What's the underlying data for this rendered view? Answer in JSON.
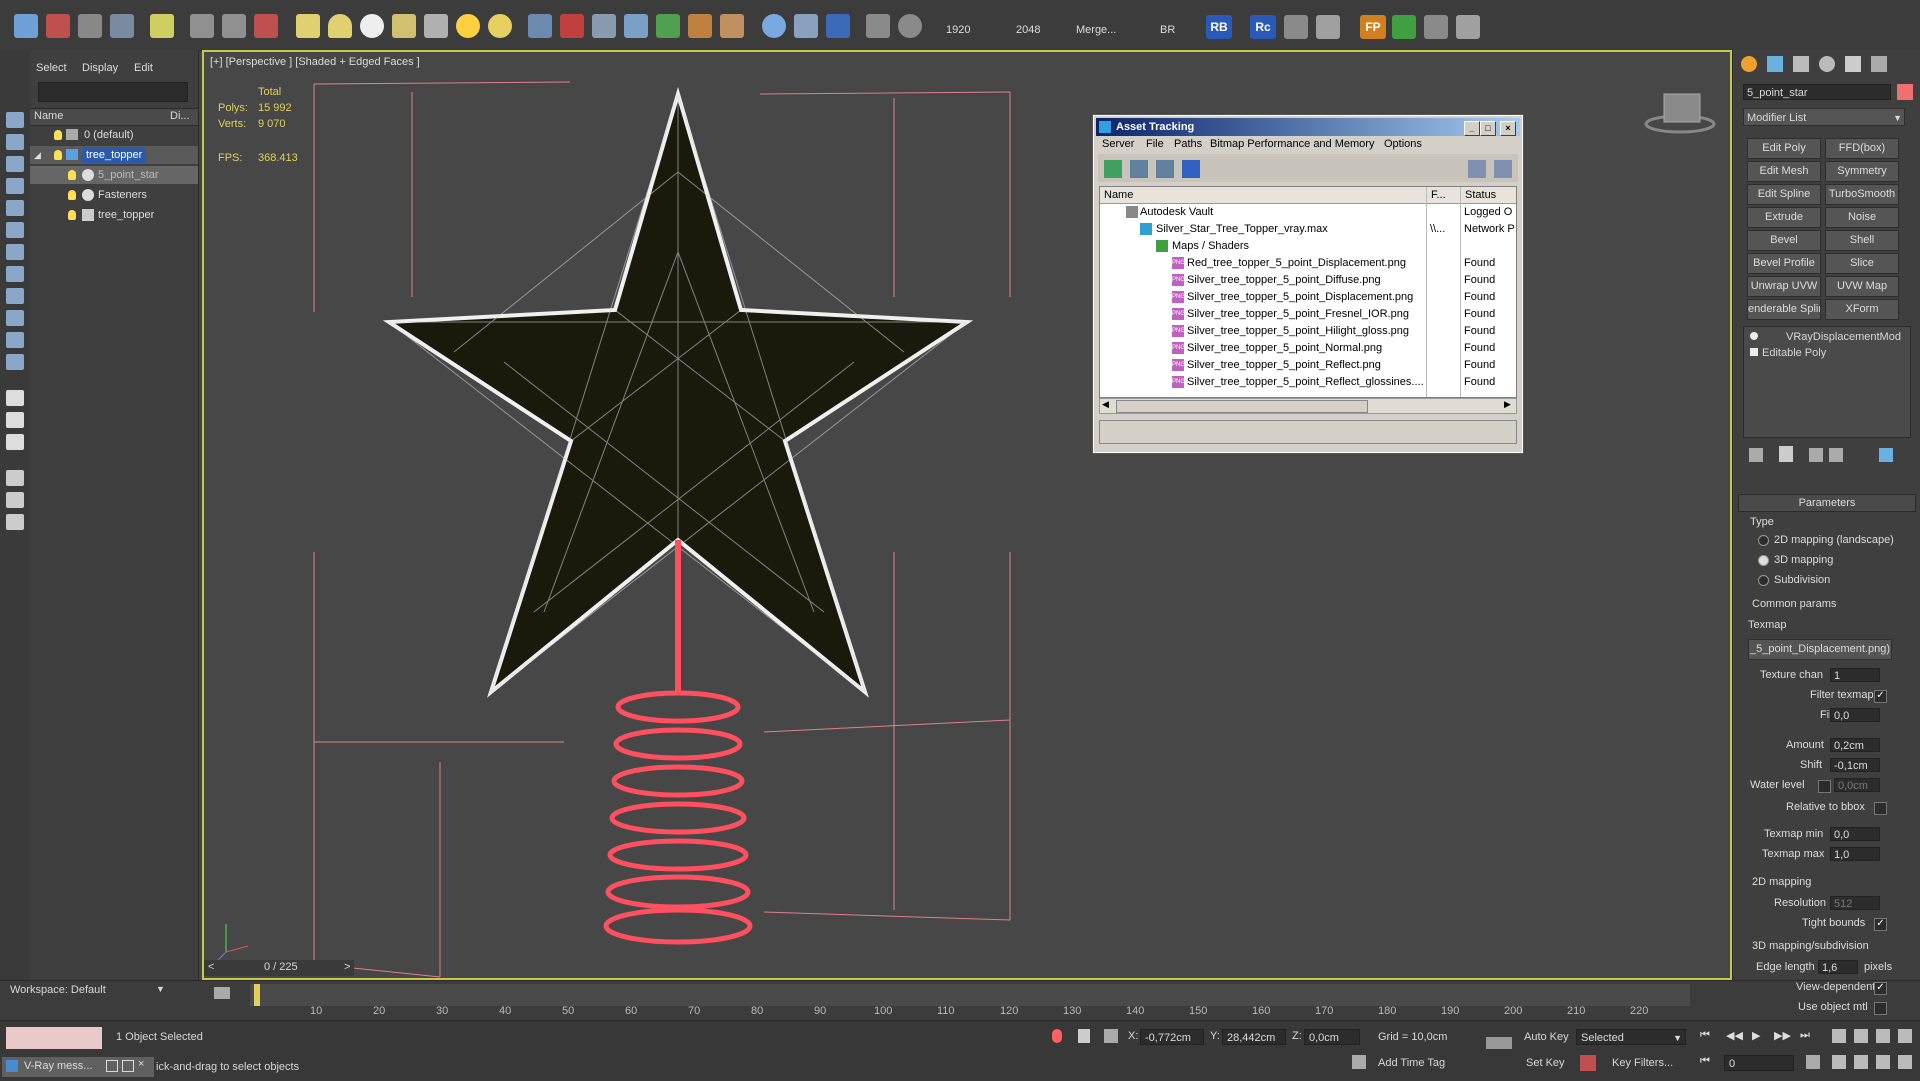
{
  "toolbar": {
    "render_width": "1920",
    "render_height": "2048",
    "merge_label": "Merge...",
    "br_label": "BR",
    "rb_label": "RB",
    "rc_label": "Rc",
    "fp_label": "FP"
  },
  "scene": {
    "menu": [
      "Select",
      "Display",
      "Edit"
    ],
    "col_name": "Name",
    "col_disp": "Di...",
    "items": [
      {
        "label": "0 (default)"
      },
      {
        "label": "tree_topper"
      },
      {
        "label": "5_point_star"
      },
      {
        "label": "Fasteners"
      },
      {
        "label": "tree_topper"
      }
    ],
    "workspace": "Workspace: Default"
  },
  "viewport": {
    "label": "[+] [Perspective ] [Shaded + Edged Faces ]",
    "stats_total": "Total",
    "polys_label": "Polys:",
    "polys_value": "15 992",
    "verts_label": "Verts:",
    "verts_value": "9 070",
    "fps_label": "FPS:",
    "fps_value": "368.413",
    "frame_counter": "0 / 225"
  },
  "asset_tracking": {
    "title": "Asset Tracking",
    "menu": [
      "Server",
      "File",
      "Paths",
      "Bitmap Performance and Memory",
      "Options"
    ],
    "col_name": "Name",
    "col_f": "F...",
    "col_status": "Status",
    "rows": [
      {
        "name": "Autodesk Vault",
        "f": "",
        "status": "Logged O"
      },
      {
        "name": "Silver_Star_Tree_Topper_vray.max",
        "f": "\\\\...",
        "status": "Network P"
      },
      {
        "name": "Maps / Shaders",
        "f": "",
        "status": ""
      },
      {
        "name": "Red_tree_topper_5_point_Displacement.png",
        "f": "",
        "status": "Found"
      },
      {
        "name": "Silver_tree_topper_5_point_Diffuse.png",
        "f": "",
        "status": "Found"
      },
      {
        "name": "Silver_tree_topper_5_point_Displacement.png",
        "f": "",
        "status": "Found"
      },
      {
        "name": "Silver_tree_topper_5_point_Fresnel_IOR.png",
        "f": "",
        "status": "Found"
      },
      {
        "name": "Silver_tree_topper_5_point_Hilight_gloss.png",
        "f": "",
        "status": "Found"
      },
      {
        "name": "Silver_tree_topper_5_point_Normal.png",
        "f": "",
        "status": "Found"
      },
      {
        "name": "Silver_tree_topper_5_point_Reflect.png",
        "f": "",
        "status": "Found"
      },
      {
        "name": "Silver_tree_topper_5_point_Reflect_glossines....",
        "f": "",
        "status": "Found"
      }
    ]
  },
  "modify": {
    "object_name": "5_point_star",
    "modifier_list": "Modifier List",
    "buttons": [
      "Edit Poly",
      "FFD(box)",
      "Edit Mesh",
      "Symmetry",
      "Edit Spline",
      "TurboSmooth",
      "Extrude",
      "Noise",
      "Bevel",
      "Shell",
      "Bevel Profile",
      "Slice",
      "Unwrap UVW",
      "UVW Map",
      "enderable Splir",
      "XForm"
    ],
    "stack": [
      "VRayDisplacementMod",
      "Editable Poly"
    ],
    "parameters_title": "Parameters",
    "type_label": "Type",
    "type_2d": "2D mapping (landscape)",
    "type_3d": "3D mapping",
    "type_sub": "Subdivision",
    "common_params": "Common params",
    "texmap_label": "Texmap",
    "texmap_value": "_5_point_Displacement.png)",
    "texture_chan_label": "Texture chan",
    "texture_chan_value": "1",
    "filter_texmap_label": "Filter texmap",
    "filter_blur_label": "Filter blur",
    "filter_blur_value": "0,0",
    "amount_label": "Amount",
    "amount_value": "0,2cm",
    "shift_label": "Shift",
    "shift_value": "-0,1cm",
    "water_level_label": "Water level",
    "water_level_value": "0,0cm",
    "relative_bbox_label": "Relative to bbox",
    "texmap_min_label": "Texmap min",
    "texmap_min_value": "0,0",
    "texmap_max_label": "Texmap max",
    "texmap_max_value": "1,0",
    "mapping_2d": "2D mapping",
    "resolution_label": "Resolution",
    "resolution_value": "512",
    "tight_bounds_label": "Tight bounds",
    "mapping_3d_sub": "3D mapping/subdivision",
    "edge_length_label": "Edge length",
    "edge_length_value": "1,6",
    "pixels_label": "pixels",
    "view_dependent_label": "View-dependent",
    "use_object_mtl_label": "Use object mtl"
  },
  "timeline": {
    "ticks": [
      "10",
      "20",
      "30",
      "40",
      "50",
      "60",
      "70",
      "80",
      "90",
      "100",
      "110",
      "120",
      "130",
      "140",
      "150",
      "160",
      "170",
      "180",
      "190",
      "200",
      "210",
      "220"
    ]
  },
  "status": {
    "selection": "1 Object Selected",
    "prompt": "ick-and-drag to select objects",
    "x_label": "X:",
    "x_value": "-0,772cm",
    "y_label": "Y:",
    "y_value": "28,442cm",
    "z_label": "Z:",
    "z_value": "0,0cm",
    "grid": "Grid = 10,0cm",
    "add_time_tag": "Add Time Tag",
    "auto_key": "Auto Key",
    "set_key": "Set Key",
    "selected": "Selected",
    "key_filters": "Key Filters...",
    "frame_value": "0",
    "vray_tab": "V-Ray mess..."
  }
}
